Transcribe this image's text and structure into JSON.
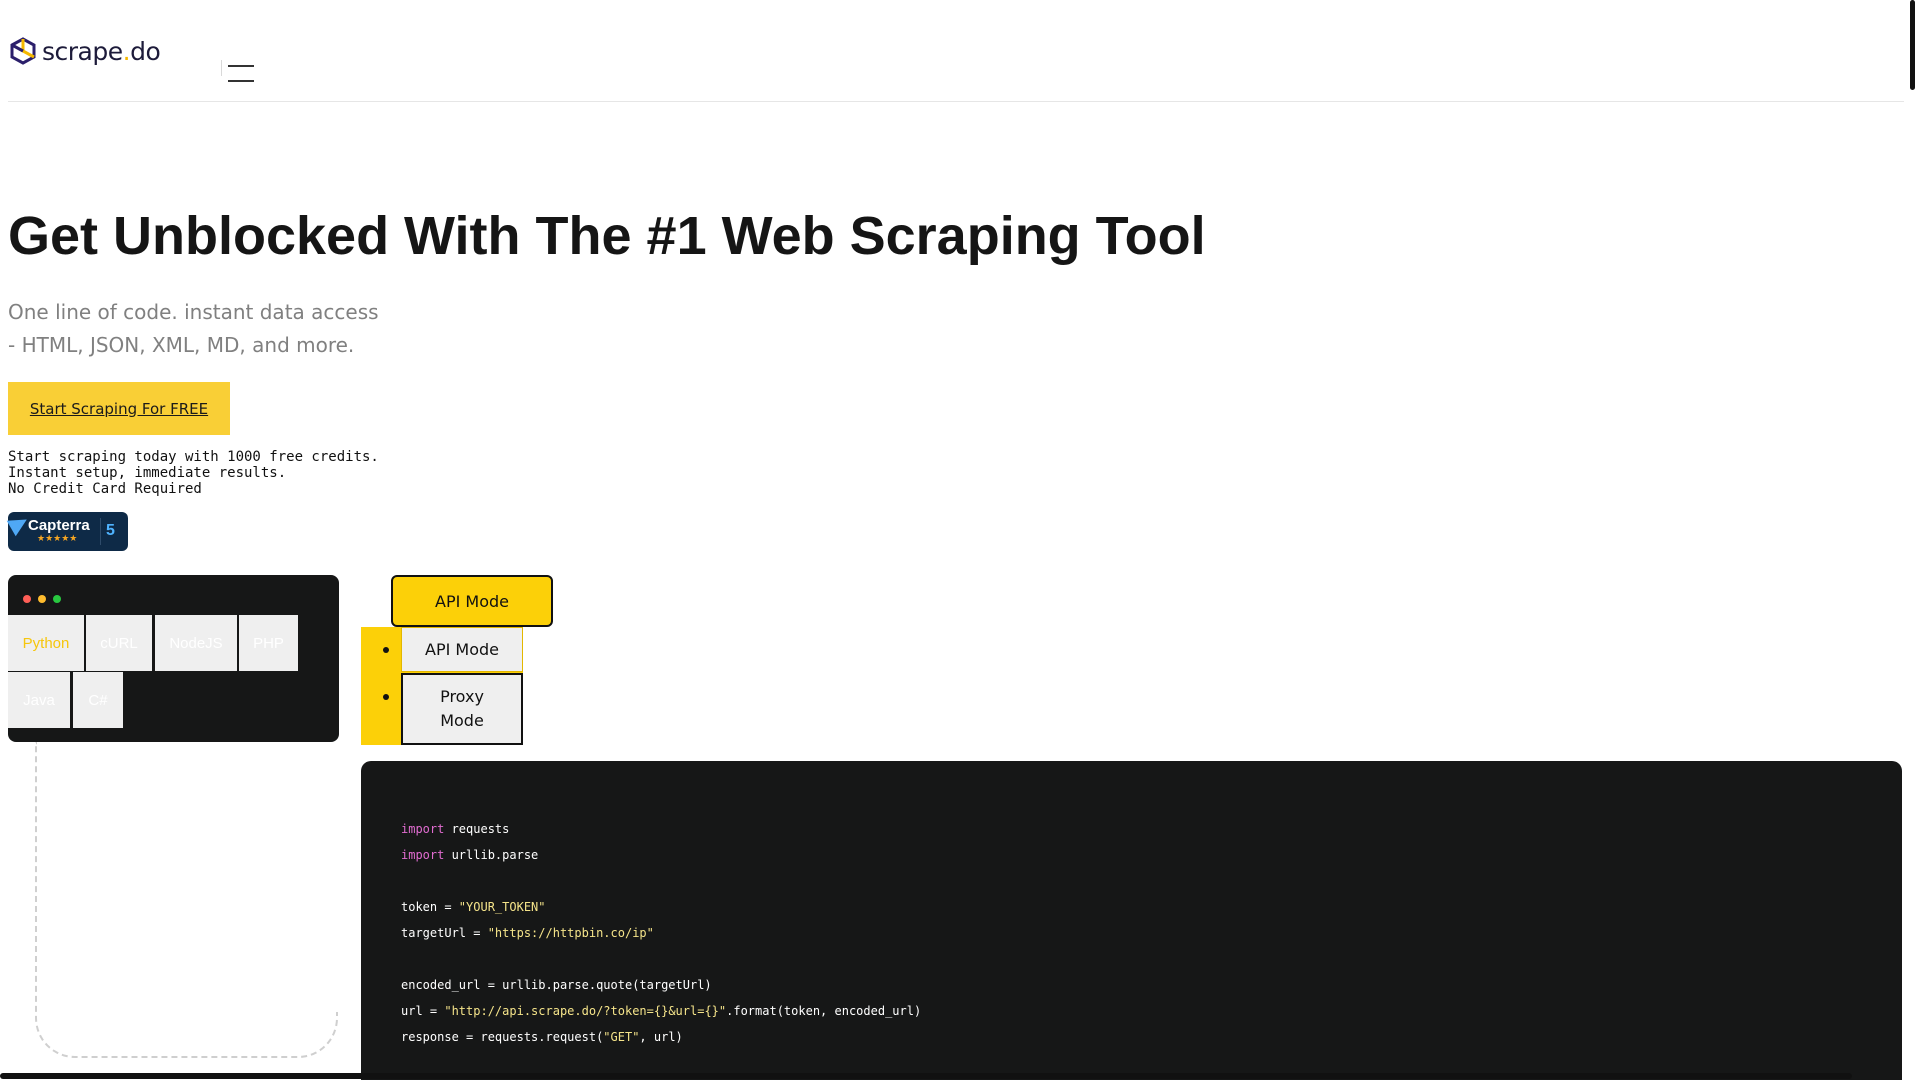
{
  "header": {
    "logo_text_main": "scrape",
    "logo_text_dot": ".",
    "logo_text_tld": "do",
    "menu_icon": "hamburger-icon"
  },
  "hero": {
    "title": "Get Unblocked With The #1 Web Scraping Tool",
    "subtitle_line1": "One line of code. instant data access",
    "subtitle_line2": "- HTML, JSON, XML, MD, and more.",
    "cta_label": "Start Scraping For FREE",
    "note_line1": "Start scraping today with 1000 free credits.",
    "note_line2": "Instant setup, immediate results.",
    "note_line3": "No Credit Card Required"
  },
  "capterra": {
    "name": "Capterra",
    "stars": "★★★★★",
    "score": "5"
  },
  "languages": {
    "tabs": [
      "Python",
      "cURL",
      "NodeJS",
      "PHP",
      "Java",
      "C#"
    ],
    "active": "Python"
  },
  "mode": {
    "selected_label": "API Mode",
    "options": [
      "API Mode",
      "Proxy Mode"
    ]
  },
  "code": {
    "line1_kw": "import",
    "line1_rest": " requests",
    "line2_kw": "import",
    "line2_rest": " urllib.parse",
    "line3_pre": "token = ",
    "line3_str": "\"YOUR_TOKEN\"",
    "line4_pre": "targetUrl = ",
    "line4_str": "\"https://httpbin.co/ip\"",
    "line5": "encoded_url = urllib.parse.quote(targetUrl)",
    "line6_pre": "url = ",
    "line6_str": "\"http://api.scrape.do/?token={}&url={}\"",
    "line6_post": ".format(token, encoded_url)",
    "line7_pre": "response = requests.request(",
    "line7_str": "\"GET\"",
    "line7_post": ", url)"
  },
  "colors": {
    "accent_yellow": "#f9cf36",
    "mode_yellow": "#fcd008",
    "code_bg": "#161717",
    "dot_red": "#ff5f57",
    "dot_yellow": "#febc2e",
    "dot_green": "#28c840"
  }
}
